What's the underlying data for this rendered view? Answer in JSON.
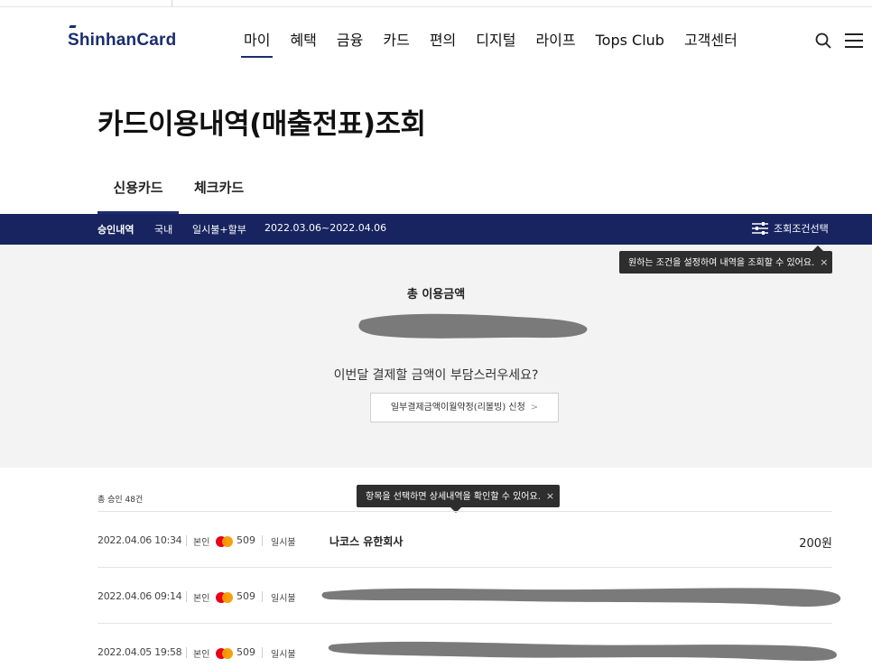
{
  "header": {
    "logo": "ShinhanCard",
    "nav": [
      "마이",
      "혜택",
      "금융",
      "카드",
      "편의",
      "디지털",
      "라이프",
      "Tops Club",
      "고객센터"
    ],
    "active_nav_index": 0
  },
  "page": {
    "title": "카드이용내역(매출전표)조회"
  },
  "tabs": {
    "credit": "신용카드",
    "check": "체크카드"
  },
  "filter": {
    "type": "승인내역",
    "region": "국내",
    "payment": "일시불+할부",
    "period": "2022.03.06~2022.04.06",
    "button_label": "조회조건선택",
    "tooltip": "원하는 조건을 설정하여 내역을 조회할 수 있어요.",
    "tooltip_close": "×"
  },
  "summary": {
    "total_label": "총 이용금액",
    "question": "이번달 결제할 금액이 부담스러우세요?",
    "revolving_button": "일부결제금액이월약정(리볼빙) 신청",
    "revolving_chevron": ">"
  },
  "list": {
    "total_count": "총 승인 48건",
    "tooltip": "항목을 선택하면 상세내역을 확인할 수 있어요.",
    "tooltip_close": "×",
    "rows": [
      {
        "datetime": "2022.04.06 10:34",
        "owner": "본인",
        "card_last": "509",
        "pay_type": "일시불",
        "merchant": "나코스 유한회사",
        "amount": "200원"
      },
      {
        "datetime": "2022.04.06 09:14",
        "owner": "본인",
        "card_last": "509",
        "pay_type": "일시불",
        "merchant": "",
        "amount": ""
      },
      {
        "datetime": "2022.04.05 19:58",
        "owner": "본인",
        "card_last": "509",
        "pay_type": "일시불",
        "merchant": "",
        "amount": ""
      }
    ]
  },
  "colors": {
    "brand_navy": "#17245f",
    "summary_bg": "#f3f3f3",
    "tooltip_bg": "#2e2e2e"
  },
  "icons": {
    "search": "search-icon",
    "menu": "menu-icon",
    "filter": "filter-icon",
    "card_brand": "mastercard-icon"
  }
}
